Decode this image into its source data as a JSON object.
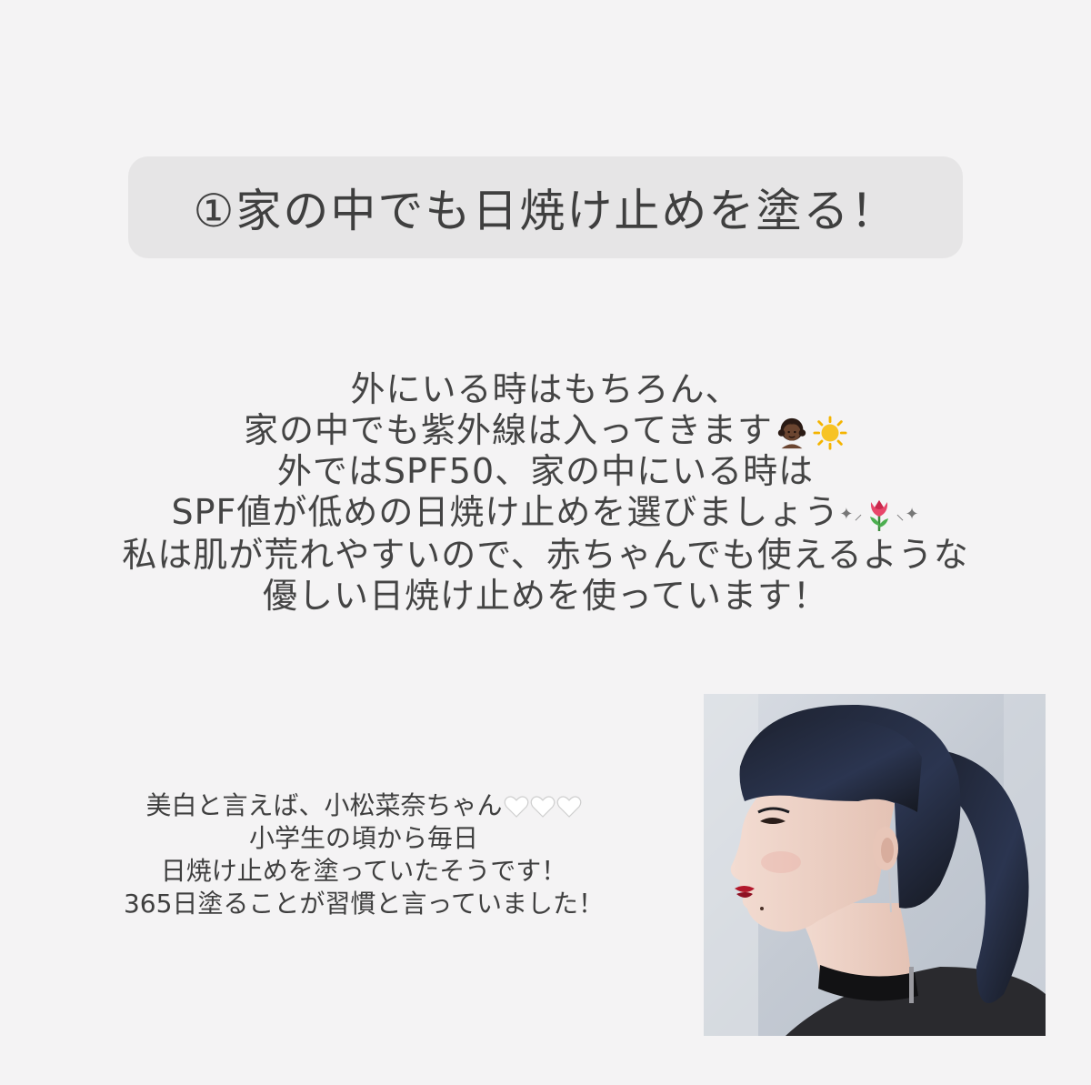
{
  "title": "①家の中でも日焼け止めを塗る！",
  "main_lines": [
    "外にいる時はもちろん、",
    "家の中でも紫外線は入ってきます",
    "外ではSPF50、家の中にいる時は",
    "SPF値が低めの日焼け止めを選びましょう",
    "私は肌が荒れやすいので、赤ちゃんでも使えるような",
    "優しい日焼け止めを使っています！"
  ],
  "sub_lines": [
    "美白と言えば、小松菜奈ちゃん",
    "小学生の頃から毎日",
    "日焼け止めを塗っていたそうです！",
    "365日塗ることが習慣と言っていました！"
  ],
  "icons": {
    "girl": "girl-emoji-icon",
    "sun": "sun-emoji-icon",
    "tulip": "tulip-emoji-icon",
    "sparkles": "sparkles-icon",
    "heart": "white-heart-icon"
  },
  "colors": {
    "background": "#f4f3f4",
    "title_box": "#e6e5e6",
    "text": "#444444"
  }
}
